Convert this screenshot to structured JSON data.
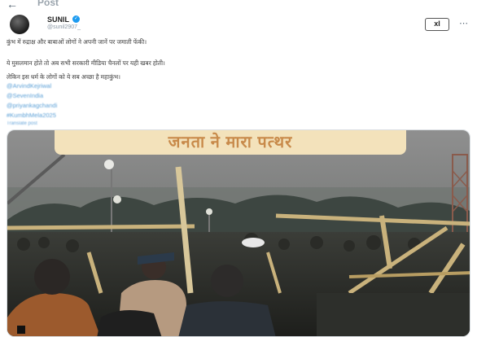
{
  "topbar": {
    "back_glyph": "←",
    "title": "Post"
  },
  "author": {
    "name": "SUNIL",
    "handle": "@sunil2907_",
    "verified": true
  },
  "toolbar": {
    "grok_label": "xI",
    "more_glyph": "⋯"
  },
  "tweet": {
    "lines": [
      "कुंभ में रुद्राक्ष और बाबाओं लोगों ने अपनी जानें पर जमाती फेंकी।",
      "ये मुसलमान होते तो अब सभी सरकारी मीडिया चैनलों पर यही खबर होती।",
      "लेकिन इस धर्म के लोगों को ये सब अच्छा है महाकुंभ।"
    ],
    "hashtags": [
      "@ArvindKejriwal",
      "@SevenIndia",
      "@priyankagchandi",
      "#KumbhMela2025"
    ],
    "translate_label": "Translate post"
  },
  "media": {
    "caption": "जनता ने मारा पत्थर",
    "kind": "video-still",
    "description_icon": "video-frame"
  },
  "colors": {
    "accent": "#1d9bf0",
    "hashtag": "#5a9fd6",
    "caption_bg": "#f3e2bb",
    "caption_text": "#c88a4a"
  }
}
